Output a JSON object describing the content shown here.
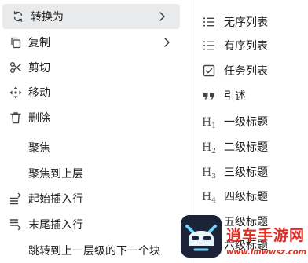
{
  "context_menu": {
    "items": [
      {
        "label": "转换为",
        "icon": "convert-icon",
        "has_submenu": true,
        "active": true
      },
      {
        "label": "复制",
        "icon": "copy-icon",
        "has_submenu": true
      },
      {
        "label": "剪切",
        "icon": "scissors-icon"
      },
      {
        "label": "移动",
        "icon": "move-icon"
      },
      {
        "label": "删除",
        "icon": "trash-icon"
      },
      {
        "label": "聚焦",
        "icon": null
      },
      {
        "label": "聚焦到上层",
        "icon": null
      },
      {
        "label": "起始插入行",
        "icon": "insert-line-top-icon"
      },
      {
        "label": "末尾插入行",
        "icon": "insert-line-bottom-icon"
      },
      {
        "label": "跳转到上一层级的下一个块",
        "icon": null
      }
    ]
  },
  "submenu": {
    "items": [
      {
        "label": "无序列表",
        "icon": "bullet-list-icon"
      },
      {
        "label": "有序列表",
        "icon": "numbered-list-icon"
      },
      {
        "label": "任务列表",
        "icon": "checkbox-icon"
      },
      {
        "label": "引述",
        "icon": "quote-icon"
      },
      {
        "label": "一级标题",
        "glyph": "H",
        "glyph_sub": "1"
      },
      {
        "label": "二级标题",
        "glyph": "H",
        "glyph_sub": "2"
      },
      {
        "label": "三级标题",
        "glyph": "H",
        "glyph_sub": "3"
      },
      {
        "label": "四级标题",
        "glyph": "H",
        "glyph_sub": "4"
      },
      {
        "label": "五级标题",
        "glyph": "H",
        "glyph_sub": "5"
      },
      {
        "label": "六级标题",
        "glyph": "H",
        "glyph_sub": "6"
      }
    ]
  },
  "watermark": {
    "title": "逍车手游网",
    "url": "www.lmwwsz.com"
  },
  "colors": {
    "menu_bg": "#ffffff",
    "active_bg": "#e9eaec",
    "text": "#222222",
    "icon": "#444444",
    "watermark_red": "#e02b20"
  }
}
